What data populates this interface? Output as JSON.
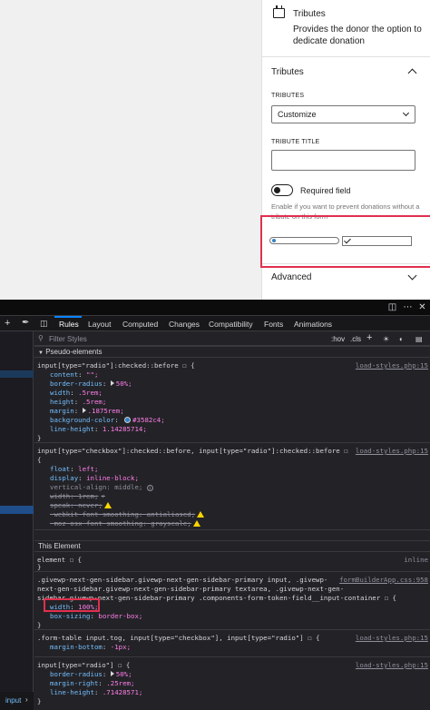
{
  "sidebar": {
    "block": {
      "title": "Tributes",
      "description": "Provides the donor the option to dedicate donation"
    },
    "panel_title": "Tributes",
    "tributes_label": "TRIBUTES",
    "tributes_value": "Customize",
    "tribute_title_label": "TRIBUTE TITLE",
    "required_label": "Required field",
    "required_on": false,
    "help_text": "Enable if you want to prevent donations without a tribute on this form",
    "advanced_label": "Advanced"
  },
  "devtools": {
    "tabs": [
      "Rules",
      "Layout",
      "Computed",
      "Changes",
      "Compatibility",
      "Fonts",
      "Animations"
    ],
    "active_tab": "Rules",
    "filter_placeholder": "Filter Styles",
    "toolbar": {
      "hov": ":hov",
      "cls": ".cls",
      "add": "+"
    },
    "sections": {
      "pseudo": "Pseudo-elements",
      "this_element": "This Element"
    },
    "rules": {
      "r1_selector": "input[type=\"radio\"]:checked::before ☐ {",
      "r1_source": "load-styles.php:15",
      "r1_props": [
        {
          "name": "content",
          "value": "\"\";"
        },
        {
          "name": "border-radius",
          "value": "50%;"
        },
        {
          "name": "width",
          "value": ".5rem;"
        },
        {
          "name": "height",
          "value": ".5rem;"
        },
        {
          "name": "margin",
          "value": ".1875rem;"
        },
        {
          "name": "background-color",
          "value": "#3582c4;"
        },
        {
          "name": "line-height",
          "value": "1.14285714;"
        }
      ],
      "r2_selector": "input[type=\"checkbox\"]:checked::before, input[type=\"radio\"]:checked::before ☐",
      "r2_brace": "{",
      "r2_source": "load-styles.php:15",
      "r2_props": [
        {
          "name": "float",
          "value": "left;"
        },
        {
          "name": "display",
          "value": "inline-block;"
        },
        {
          "name": "vertical-align",
          "value": "middle;"
        },
        {
          "name": "width",
          "value": "1rem;"
        },
        {
          "name": "speak",
          "value": "never;"
        },
        {
          "name": "-webkit-font-smoothing",
          "value": "antialiased;"
        },
        {
          "name": "-moz-osx-font-smoothing",
          "value": "grayscale;"
        }
      ],
      "r3_selector": "element ☐ {",
      "r3_source": "inline",
      "r4_selector_1": ".givewp-next-gen-sidebar.givewp-next-gen-sidebar-primary input, .givewp-",
      "r4_selector_2": "next-gen-sidebar.givewp-next-gen-sidebar-primary textarea, .givewp-next-gen-",
      "r4_selector_3": "sidebar.givewp-next-gen-sidebar-primary .components-form-token-field__input-container ☐ {",
      "r4_source": "formBuilderApp.css:958",
      "r4_props": [
        {
          "name": "width",
          "value": "100%;"
        },
        {
          "name": "box-sizing",
          "value": "border-box;"
        }
      ],
      "r5_selector": ".form-table input.tog, input[type=\"checkbox\"], input[type=\"radio\"] ☐ {",
      "r5_source": "load-styles.php:15",
      "r5_props": [
        {
          "name": "margin-bottom",
          "value": "-1px;"
        }
      ],
      "r6_selector": "input[type=\"radio\"] ☐ {",
      "r6_source": "load-styles.php:15",
      "r6_props": [
        {
          "name": "border-radius",
          "value": "50%;"
        },
        {
          "name": "margin-right",
          "value": ".25rem;"
        },
        {
          "name": "line-height",
          "value": ".71428571;"
        }
      ]
    },
    "breadcrumb": "input"
  }
}
